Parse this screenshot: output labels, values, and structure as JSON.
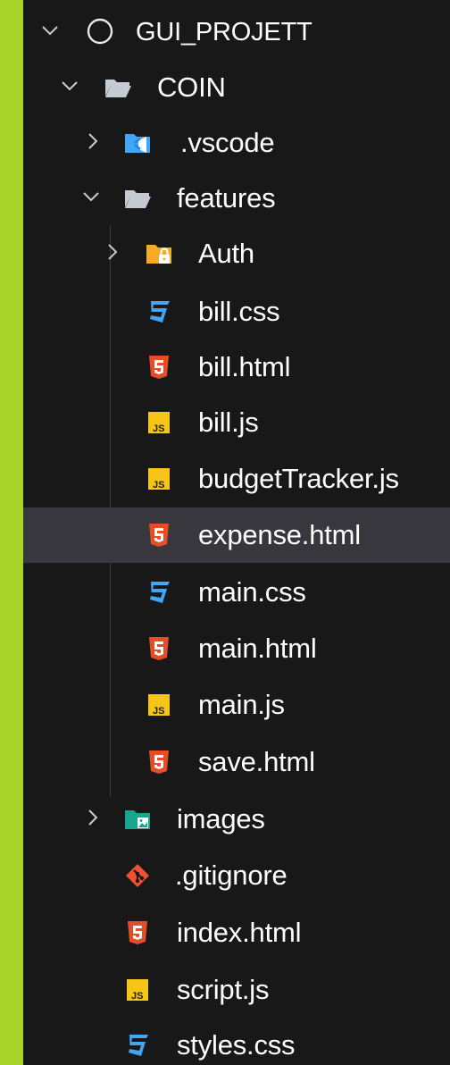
{
  "explorer": {
    "root": {
      "label": "GUI_PROJETT",
      "icon": "circle-outline-icon"
    },
    "coin": {
      "label": "COIN",
      "icon": "folder-open-icon"
    },
    "vscode": {
      "label": ".vscode",
      "icon": "vscode-folder-icon"
    },
    "features": {
      "label": "features",
      "icon": "folder-open-icon"
    },
    "auth": {
      "label": "Auth",
      "icon": "lock-folder-icon"
    },
    "bill_css": {
      "label": "bill.css",
      "icon": "css-icon"
    },
    "bill_html": {
      "label": "bill.html",
      "icon": "html-icon"
    },
    "bill_js": {
      "label": "bill.js",
      "icon": "js-icon"
    },
    "budget_js": {
      "label": "budgetTracker.js",
      "icon": "js-icon"
    },
    "expense_html": {
      "label": "expense.html",
      "icon": "html-icon",
      "selected": true
    },
    "main_css": {
      "label": "main.css",
      "icon": "css-icon"
    },
    "main_html": {
      "label": "main.html",
      "icon": "html-icon"
    },
    "main_js": {
      "label": "main.js",
      "icon": "js-icon"
    },
    "save_html": {
      "label": "save.html",
      "icon": "html-icon"
    },
    "images": {
      "label": "images",
      "icon": "image-folder-icon"
    },
    "gitignore": {
      "label": ".gitignore",
      "icon": "git-icon"
    },
    "index_html": {
      "label": "index.html",
      "icon": "html-icon"
    },
    "script_js": {
      "label": "script.js",
      "icon": "js-icon"
    },
    "styles_css": {
      "label": "styles.css",
      "icon": "css-icon"
    }
  },
  "colors": {
    "frame": "#a8d42a",
    "background": "#181818",
    "selection": "#37373d",
    "html": "#e44d26",
    "css": "#42a5f5",
    "js": "#f5c518",
    "folder": "#c5cbd3",
    "git": "#f05133"
  }
}
